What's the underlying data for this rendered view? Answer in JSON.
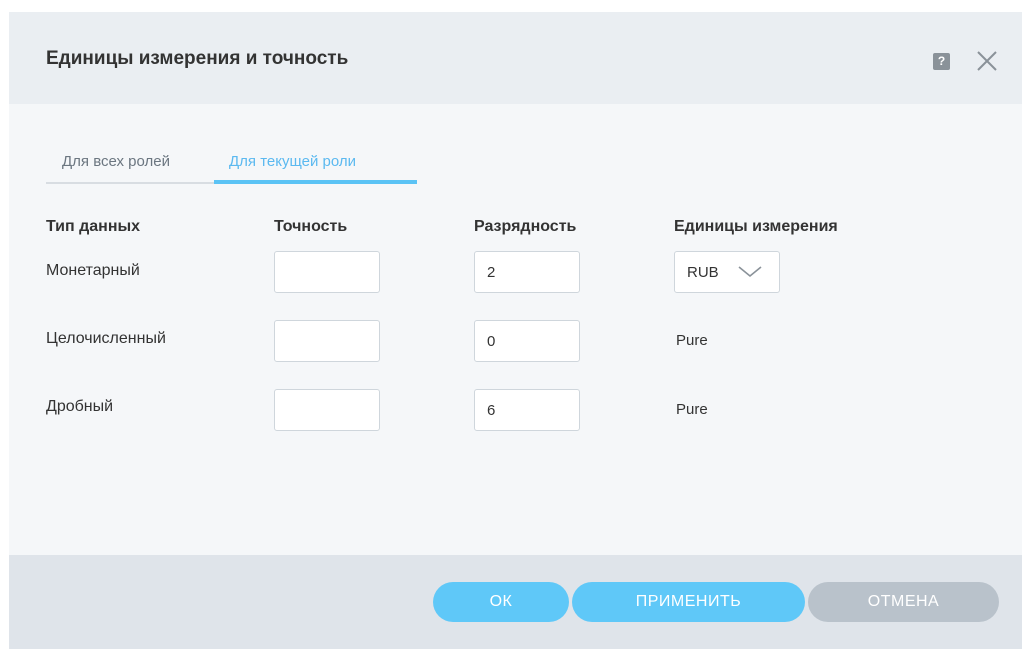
{
  "dialog": {
    "title": "Единицы измерения и точность",
    "help_icon": "help-icon",
    "help_glyph": "?",
    "close_icon": "close-icon"
  },
  "tabs": [
    {
      "label": "Для всех ролей",
      "active": false
    },
    {
      "label": "Для текущей роли",
      "active": true
    }
  ],
  "table": {
    "headers": [
      "Тип данных",
      "Точность",
      "Разрядность",
      "Единицы измерения"
    ],
    "rows": [
      {
        "type": "Монетарный",
        "precision": "",
        "digits": "2",
        "unit": "RUB",
        "unit_kind": "select"
      },
      {
        "type": "Целочисленный",
        "precision": "",
        "digits": "0",
        "unit": "Pure",
        "unit_kind": "text"
      },
      {
        "type": "Дробный",
        "precision": "",
        "digits": "6",
        "unit": "Pure",
        "unit_kind": "text"
      }
    ]
  },
  "buttons": {
    "ok": "ОК",
    "apply": "ПРИМЕНИТЬ",
    "cancel": "ОТМЕНА"
  },
  "colors": {
    "accent": "#5fc8f8",
    "tab_active": "#5bb9f0",
    "cancel_button": "#b9c2cb",
    "header_bg": "#eaeef2",
    "footer_bg": "#dfe4ea"
  }
}
